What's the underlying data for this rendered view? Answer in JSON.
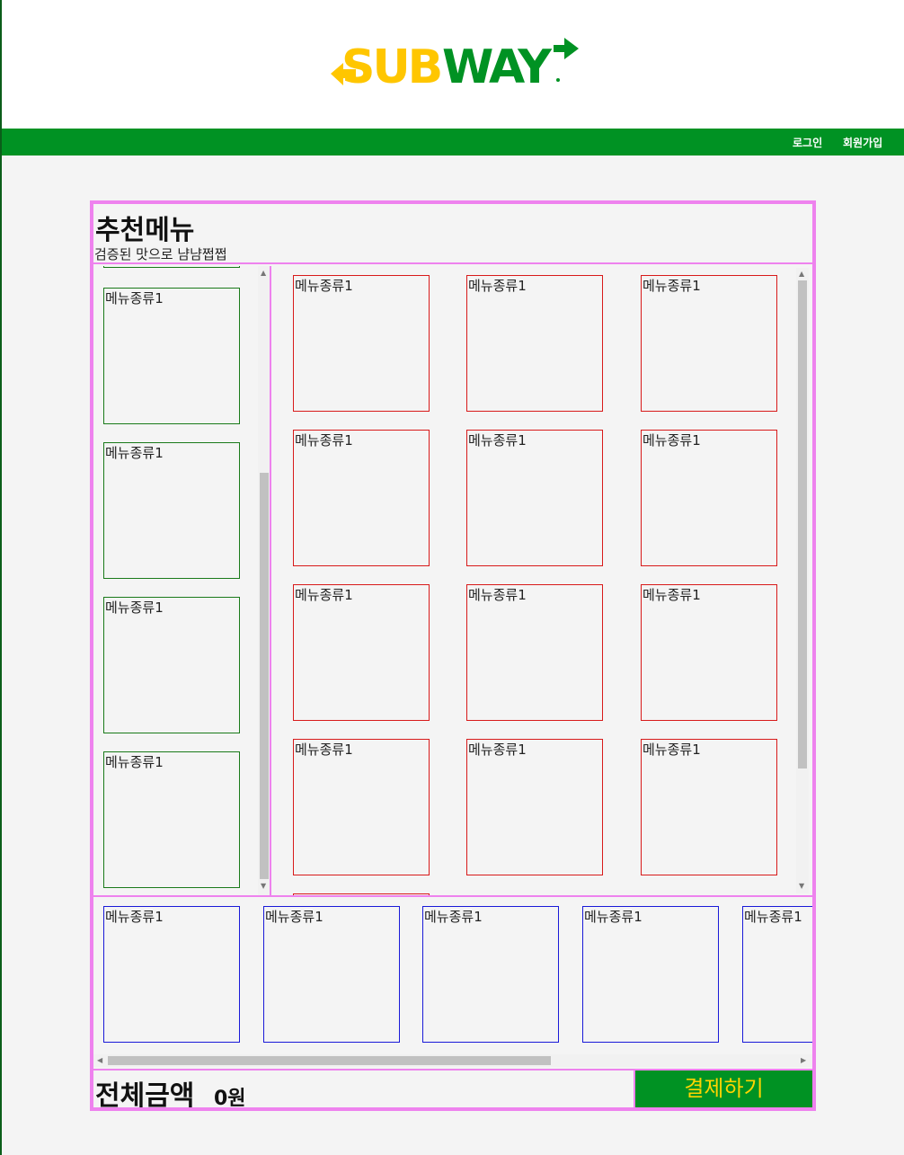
{
  "header": {
    "logo_text_yellow": "SUB",
    "logo_text_green": "WAY",
    "brand_yellow": "#ffc600",
    "brand_green": "#009223"
  },
  "nav": {
    "login": "로그인",
    "signup": "회원가입"
  },
  "recommend": {
    "title": "추천메뉴",
    "subtitle": "검증된 맛으로 냠냠쩝쩝"
  },
  "categories": [
    {
      "label": "메뉴종류1"
    },
    {
      "label": "메뉴종류1"
    },
    {
      "label": "메뉴종류1"
    },
    {
      "label": "메뉴종류1"
    }
  ],
  "menu_items": [
    {
      "label": "메뉴종류1"
    },
    {
      "label": "메뉴종류1"
    },
    {
      "label": "메뉴종류1"
    },
    {
      "label": "메뉴종류1"
    },
    {
      "label": "메뉴종류1"
    },
    {
      "label": "메뉴종류1"
    },
    {
      "label": "메뉴종류1"
    },
    {
      "label": "메뉴종류1"
    },
    {
      "label": "메뉴종류1"
    },
    {
      "label": "메뉴종류1"
    },
    {
      "label": "메뉴종류1"
    },
    {
      "label": "메뉴종류1"
    }
  ],
  "cart_items": [
    {
      "label": "메뉴종류1"
    },
    {
      "label": "메뉴종류1"
    },
    {
      "label": "메뉴종류1"
    },
    {
      "label": "메뉴종류1"
    },
    {
      "label": "메뉴종류1"
    }
  ],
  "footer": {
    "total_label": "전체금액",
    "total_value": "0원",
    "pay_button": "결제하기"
  }
}
